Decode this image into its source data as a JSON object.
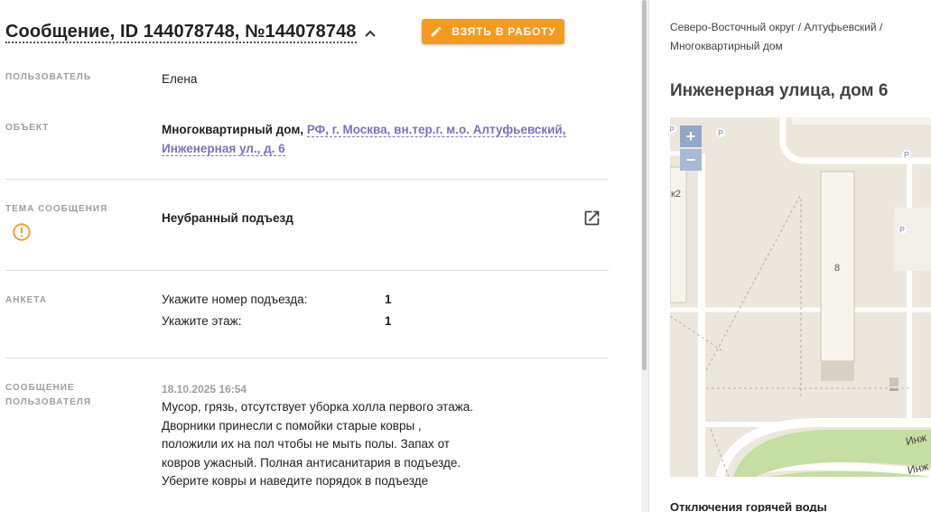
{
  "header": {
    "title": "Сообщение, ID 144078748, №144078748",
    "work_button_label": "ВЗЯТЬ В РАБОТУ"
  },
  "fields": {
    "user": {
      "label": "ПОЛЬЗОВАТЕЛЬ",
      "value": "Елена"
    },
    "object": {
      "label": "ОБЪЕКТ",
      "type": "Многоквартирный дом,",
      "address_line1": "РФ, г. Москва, вн.тер.г. м.о. Алтуфьевский,",
      "address_line2": "Инженерная ул., д. 6"
    },
    "topic": {
      "label": "ТЕМА СООБЩЕНИЯ",
      "value": "Неубранный подъезд"
    },
    "survey": {
      "label": "АНКЕТА",
      "items": [
        {
          "question": "Укажите номер подъезда:",
          "answer": "1"
        },
        {
          "question": "Укажите этаж:",
          "answer": "1"
        }
      ]
    },
    "message": {
      "label_line1": "СООБЩЕНИЕ",
      "label_line2": "ПОЛЬЗОВАТЕЛЯ",
      "date": "18.10.2025 16:54",
      "lines": [
        "Мусор, грязь, отсутствует уборка холла первого этажа.",
        "Дворники принесли с помойки старые ковры ,",
        "положили их на пол чтобы не мыть полы. Запах от",
        "ковров ужасный. Полная антисанитария в подъезде.",
        "Уберите ковры и наведите порядок в подъезде"
      ]
    }
  },
  "sidebar": {
    "breadcrumb_line1": "Северо-Восточный округ / Алтуфьевский /",
    "breadcrumb_line2": "Многоквартирный дом",
    "address_title": "Инженерная улица, дом 6",
    "map": {
      "zoom_in": "+",
      "zoom_out": "−",
      "building_number": "8",
      "label_k2": "к2",
      "parking": "P",
      "street_label_1": "Инж",
      "street_label_2": "Инж"
    },
    "outages_title": "Отключения горячей воды"
  },
  "colors": {
    "accent": "#f59a1c",
    "link": "#7e6fc4",
    "label": "#9e9e9e"
  }
}
